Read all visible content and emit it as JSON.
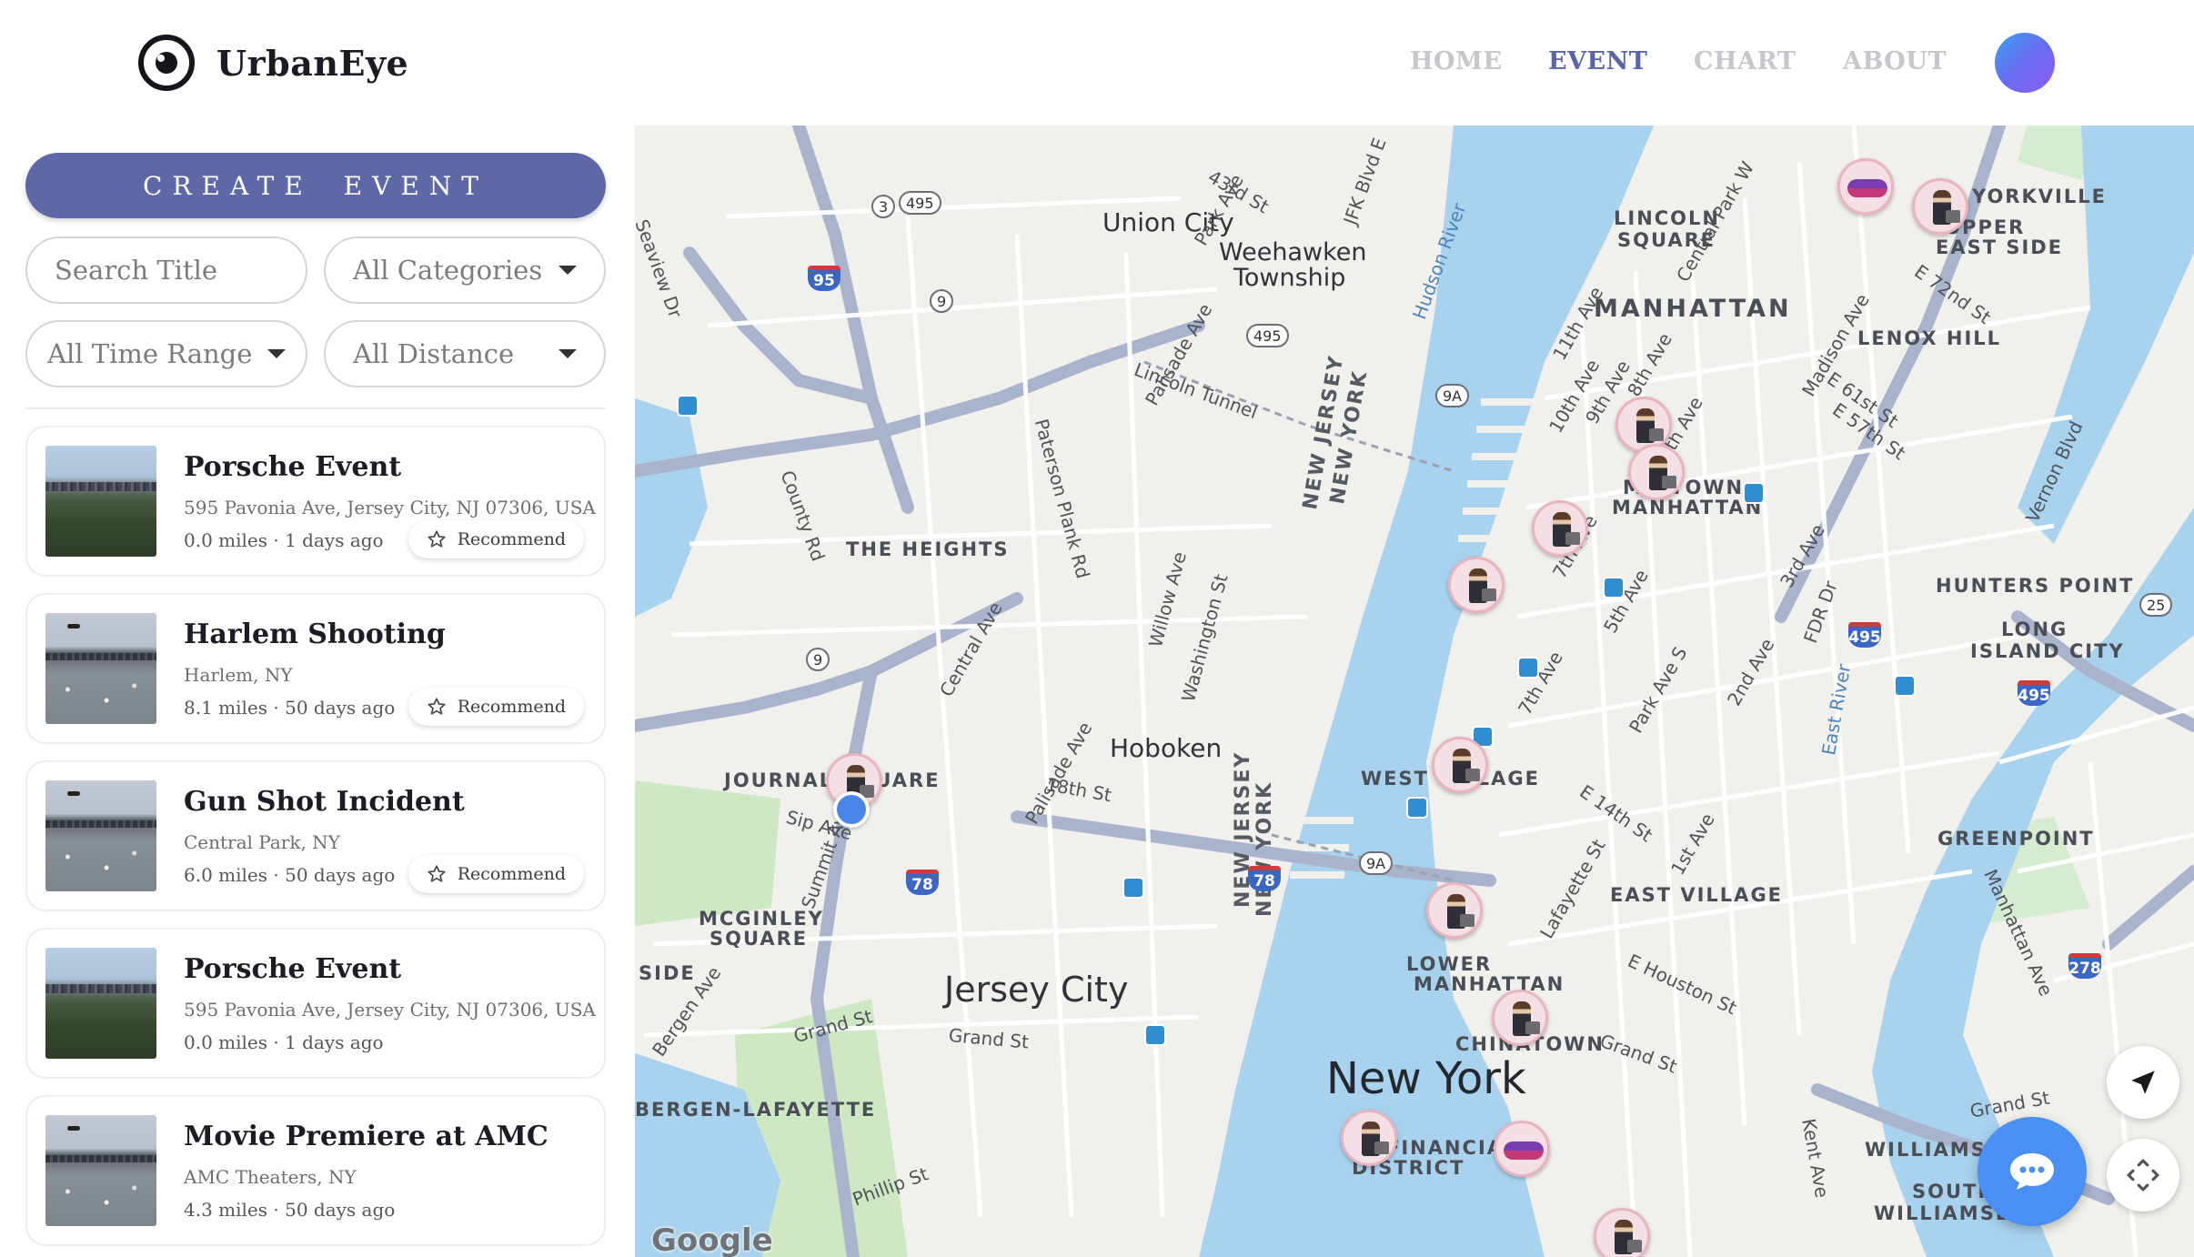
{
  "brand": {
    "name": "UrbanEye",
    "logo_icon": "eye-icon"
  },
  "nav": {
    "items": [
      {
        "label": "HOME",
        "active": false
      },
      {
        "label": "EVENT",
        "active": true
      },
      {
        "label": "CHART",
        "active": false
      },
      {
        "label": "ABOUT",
        "active": false
      }
    ],
    "active_color": "#5a64a7",
    "inactive_color": "#c6c6cc"
  },
  "sidebar": {
    "create_label": "CREATE EVENT",
    "search_placeholder": "Search Title",
    "filters": {
      "category": "All Categories",
      "time_range": "All Time Range",
      "distance": "All Distance"
    },
    "recommend_label": "Recommend",
    "events": [
      {
        "title": "Porsche Event",
        "address": "595 Pavonia Ave, Jersey City, NJ 07306, USA",
        "meta": "0.0 miles · 1 days ago",
        "recommend": true,
        "thumb": "city"
      },
      {
        "title": "Harlem Shooting",
        "address": "Harlem, NY",
        "meta": "8.1 miles · 50 days ago",
        "recommend": true,
        "thumb": "river"
      },
      {
        "title": "Gun Shot Incident",
        "address": "Central Park, NY",
        "meta": "6.0 miles · 50 days ago",
        "recommend": true,
        "thumb": "river"
      },
      {
        "title": "Porsche Event",
        "address": "595 Pavonia Ave, Jersey City, NJ 07306, USA",
        "meta": "0.0 miles · 1 days ago",
        "recommend": false,
        "thumb": "city"
      },
      {
        "title": "Movie Premiere at AMC",
        "address": "AMC Theaters, NY",
        "meta": "4.3 miles · 50 days ago",
        "recommend": false,
        "thumb": "river"
      }
    ]
  },
  "map": {
    "labels": {
      "union_city": "Union City",
      "weehawken": "Weehawken",
      "township": "Township",
      "lincoln_square": "LINCOLN",
      "lincoln_square2": "SQUARE",
      "manhattan": "MANHATTAN",
      "yorkville": "YORKVILLE",
      "upper_east": "UPPER",
      "east_side": "EAST SIDE",
      "lenox_hill": "LENOX HILL",
      "midtown": "MIDTOWN",
      "midtown2": "MANHATTAN",
      "the_heights": "THE HEIGHTS",
      "hoboken": "Hoboken",
      "hunters_point": "HUNTERS POINT",
      "long_island": "LONG",
      "island_city": "ISLAND CITY",
      "journal_square": "JOURNAL SQUARE",
      "west_village": "WEST VILLAGE",
      "greenpoint": "GREENPOINT",
      "east_village": "EAST VILLAGE",
      "mcginley": "MCGINLEY",
      "mcginley2": "SQUARE",
      "side": "SIDE",
      "lower_manhattan": "LOWER",
      "lower_manhattan2": "MANHATTAN",
      "jersey_city": "Jersey City",
      "chinatown": "CHINATOWN",
      "new_york": "New York",
      "bergen_lafayette": "BERGEN-LAFAYETTE",
      "financial": "FINANCIAL",
      "district": "DISTRICT",
      "williamsburg": "WILLIAMSBURG",
      "south_williamsburg": "SOUTH",
      "south_williamsburg2": "WILLIAMSBURG",
      "nj": "NEW JERSEY",
      "ny": "NEW YORK",
      "hudson": "Hudson River",
      "east_river": "East River",
      "lincoln_tunnel": "Lincoln Tunnel",
      "grand_st": "Grand St",
      "sip_ave": "Sip Ave",
      "street_18th": "18th St",
      "phillip_st": "Phillip St",
      "e14th": "E 14th St",
      "e_houston": "E Houston St",
      "park_ave": "Park Ave",
      "seventh_ave": "7th Ave",
      "fifth_ave": "5th Ave",
      "tenth_ave": "10th Ave",
      "ninth_ave": "9th Ave",
      "eleventh_ave": "11th Ave",
      "eighth_ave": "8th Ave",
      "sixth_ave": "6th Ave",
      "third_ave": "3rd Ave",
      "second_ave": "2nd Ave",
      "first_ave": "1st Ave",
      "e57": "E 57th St",
      "e61": "E 61st St",
      "e72": "E 72nd St",
      "central_ave": "Central Ave",
      "palisade_ave": "Palisade Ave",
      "paterson": "Paterson Plank Rd",
      "willow_ave": "Willow Ave",
      "washington_st": "Washington St",
      "summit_ave": "Summit Ave",
      "bergen_ave": "Bergen Ave",
      "county_rd": "County Rd",
      "lafayette_st": "Lafayette St",
      "manhattan_ave": "Manhattan Ave",
      "kent_ave": "Kent Ave",
      "fdr": "FDR Dr",
      "vernon": "Vernon Blvd",
      "madison": "Madison Ave",
      "park_ave_s": "Park Ave S",
      "seaview": "Seaview Dr",
      "central_park_w": "Central Park W",
      "jfk": "JFK Blvd E",
      "st43": "43rd St"
    },
    "route_shields": [
      "495",
      "95",
      "78",
      "278",
      "9A",
      "9",
      "3",
      "25"
    ],
    "google_mark": "Google",
    "chat_icon": "chat-bubble-icon",
    "locate_icon": "navigation-arrow-icon",
    "fullscreen_icon": "fullscreen-icon"
  }
}
